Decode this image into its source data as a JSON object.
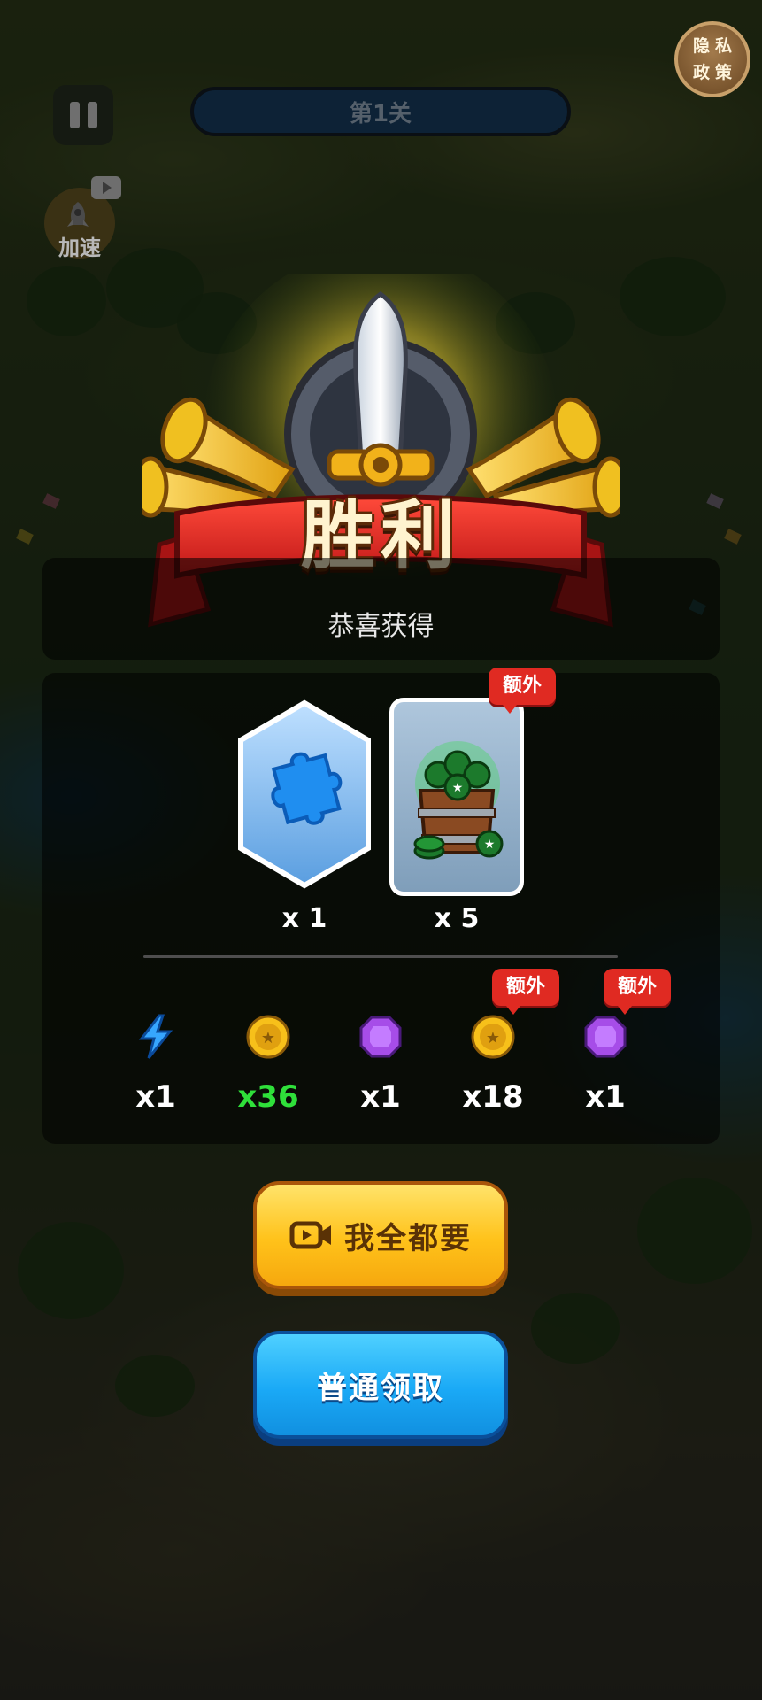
{
  "hud": {
    "level_label": "第1关",
    "privacy_label": "隐私\n政策",
    "speed_label": "加速"
  },
  "victory": {
    "title": "胜利",
    "subtitle": "恭喜获得"
  },
  "rewards": {
    "main": [
      {
        "icon": "puzzle-piece-icon",
        "quantity": "x 1",
        "extra": false
      },
      {
        "icon": "coin-barrel-icon",
        "quantity": "x 5",
        "extra": true,
        "extra_label": "额外"
      }
    ],
    "items": [
      {
        "icon": "lightning-icon",
        "quantity": "x1",
        "extra": false
      },
      {
        "icon": "gold-coin-icon",
        "quantity": "x36",
        "extra": false,
        "color": "#2fe03a"
      },
      {
        "icon": "purple-gem-icon",
        "quantity": "x1",
        "extra": false
      },
      {
        "icon": "gold-coin-icon",
        "quantity": "x18",
        "extra": true,
        "extra_label": "额外"
      },
      {
        "icon": "purple-gem-icon",
        "quantity": "x1",
        "extra": true,
        "extra_label": "额外"
      }
    ]
  },
  "buttons": {
    "claim_all_label": "我全都要",
    "claim_normal_label": "普通领取"
  },
  "colors": {
    "extra_tag": "#e02a22",
    "highlight_quantity": "#2fe03a",
    "claim_all_button": "#ffc21a",
    "claim_normal_button": "#1aa9f6"
  }
}
